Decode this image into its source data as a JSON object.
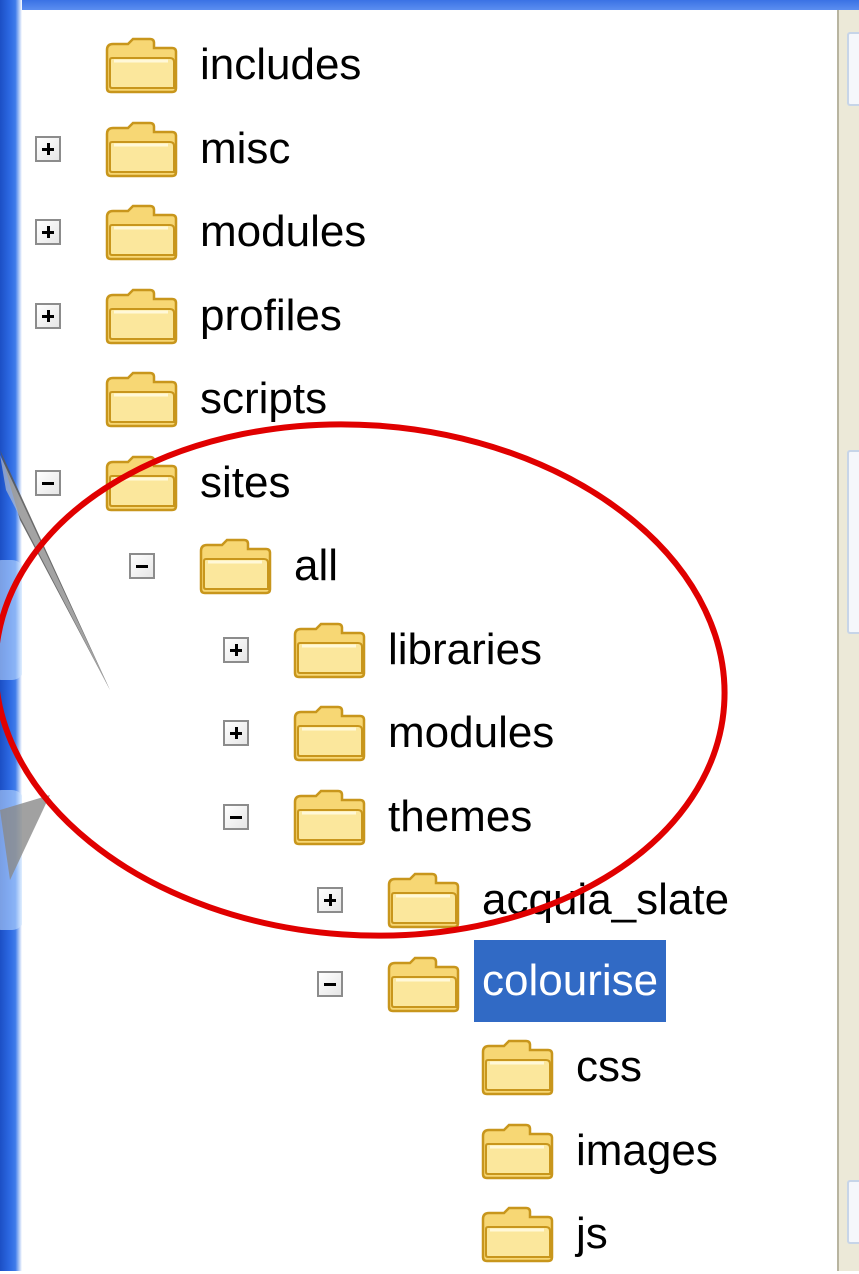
{
  "colors": {
    "selection_bg": "#316ac5",
    "selection_text": "#ffffff",
    "folder_fill": "#f7d774",
    "folder_outline": "#c8961c",
    "annotation_ellipse": "#e00000"
  },
  "tree": {
    "items": [
      {
        "label": "includes",
        "depth": 0,
        "toggle": "none",
        "selected": false
      },
      {
        "label": "misc",
        "depth": 0,
        "toggle": "expand",
        "selected": false
      },
      {
        "label": "modules",
        "depth": 0,
        "toggle": "expand",
        "selected": false
      },
      {
        "label": "profiles",
        "depth": 0,
        "toggle": "expand",
        "selected": false
      },
      {
        "label": "scripts",
        "depth": 0,
        "toggle": "none",
        "selected": false
      },
      {
        "label": "sites",
        "depth": 0,
        "toggle": "collapse",
        "selected": false
      },
      {
        "label": "all",
        "depth": 1,
        "toggle": "collapse",
        "selected": false
      },
      {
        "label": "libraries",
        "depth": 2,
        "toggle": "expand",
        "selected": false
      },
      {
        "label": "modules",
        "depth": 2,
        "toggle": "expand",
        "selected": false
      },
      {
        "label": "themes",
        "depth": 2,
        "toggle": "collapse",
        "selected": false
      },
      {
        "label": "acquia_slate",
        "depth": 3,
        "toggle": "expand",
        "selected": false
      },
      {
        "label": "colourise",
        "depth": 3,
        "toggle": "collapse",
        "selected": true
      },
      {
        "label": "css",
        "depth": 4,
        "toggle": "none",
        "selected": false
      },
      {
        "label": "images",
        "depth": 4,
        "toggle": "none",
        "selected": false
      },
      {
        "label": "js",
        "depth": 4,
        "toggle": "none",
        "selected": false
      }
    ]
  },
  "icons": {
    "folder": "folder-icon",
    "expand": "plus-box-icon",
    "collapse": "minus-box-icon"
  }
}
